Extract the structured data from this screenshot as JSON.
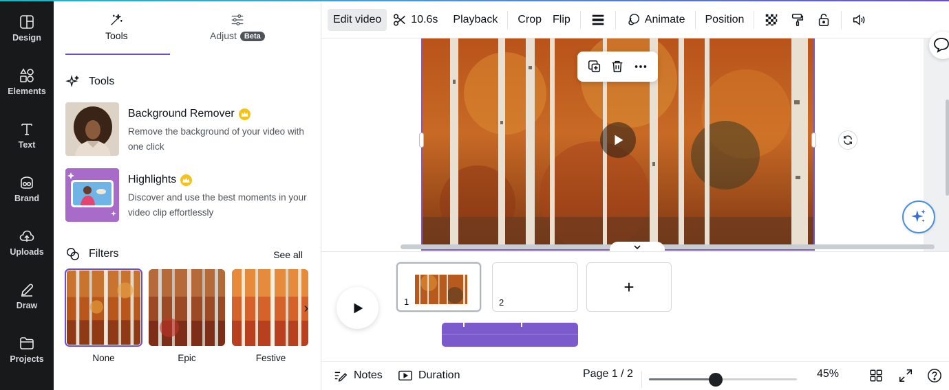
{
  "rail": {
    "items": [
      {
        "label": "Design",
        "icon": "design-icon"
      },
      {
        "label": "Elements",
        "icon": "elements-icon"
      },
      {
        "label": "Text",
        "icon": "text-icon"
      },
      {
        "label": "Brand",
        "icon": "brand-icon"
      },
      {
        "label": "Uploads",
        "icon": "cloud-upload-icon"
      },
      {
        "label": "Draw",
        "icon": "pen-icon"
      },
      {
        "label": "Projects",
        "icon": "folder-icon"
      }
    ]
  },
  "panel": {
    "tabs": [
      {
        "label": "Tools",
        "icon": "magic-wand-icon",
        "active": true
      },
      {
        "label": "Adjust",
        "badge": "Beta",
        "icon": "sliders-icon",
        "active": false
      }
    ],
    "tools_heading": "Tools",
    "tools": [
      {
        "title": "Background Remover",
        "description": "Remove the background of your video with one click",
        "premium": true
      },
      {
        "title": "Highlights",
        "description": "Discover and use the best moments in your video clip effortlessly",
        "premium": true
      }
    ],
    "filters_heading": "Filters",
    "see_all": "See all",
    "filters": [
      {
        "label": "None",
        "selected": true
      },
      {
        "label": "Epic",
        "selected": false
      },
      {
        "label": "Festive",
        "selected": false
      }
    ]
  },
  "toolbar": {
    "edit_video": "Edit video",
    "duration": "10.6s",
    "playback": "Playback",
    "crop": "Crop",
    "flip": "Flip",
    "animate": "Animate",
    "position": "Position"
  },
  "timeline": {
    "pages": [
      {
        "number": "1"
      },
      {
        "number": "2"
      }
    ],
    "add_page": "+"
  },
  "bottombar": {
    "notes": "Notes",
    "duration": "Duration",
    "page_indicator": "Page 1 / 2",
    "zoom": "45%",
    "zoom_fraction": 0.45
  },
  "colors": {
    "rail_bg": "#18191b",
    "accent_purple": "#6c4bd8",
    "audio_track": "#7b5bcc",
    "premium_crown": "#f4c21b"
  }
}
